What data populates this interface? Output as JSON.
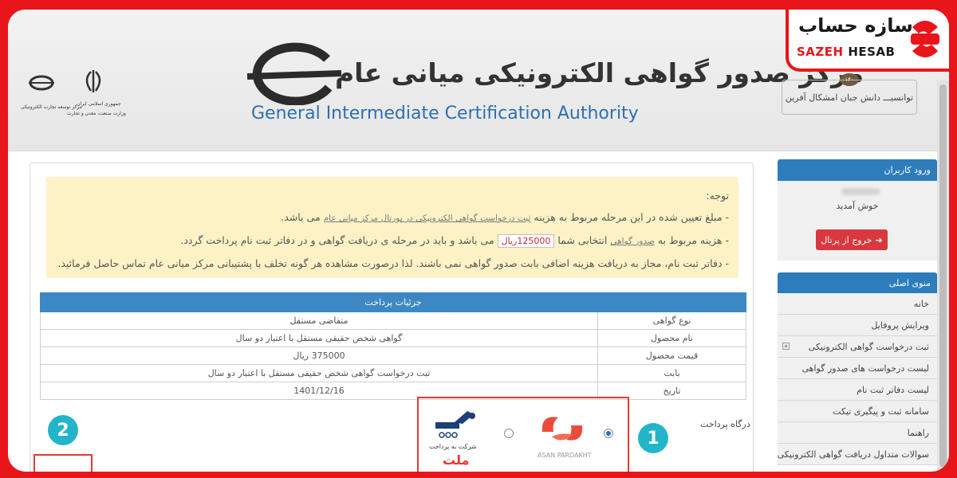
{
  "brand": {
    "name_fa": "سازه حساب",
    "name_en_red": "SAZEH",
    "name_en_dark": "HESAB"
  },
  "header": {
    "title": "مرکز صدور گواهی الکترونیکی میانی عام",
    "subtitle": "General Intermediate Certification Authority",
    "motto": "توانسیـــ دانش جبان امشکال آفرین",
    "gov_line1": "جمهوری اسلامی ایران",
    "gov_line2": "وزارت صنعت، معدن و تجارت",
    "gov_line3": "مرکز توسعه تجارت الکترونیکی"
  },
  "notice": {
    "heading": "توجه:",
    "line1_start": "- مبلغ تعیین شده در این مرحله مربوط به هزینه",
    "line1_link": "ثبت درخواست گواهی الکترونیکی در پورتال مرکز میانی عام",
    "line1_end": "می باشد.",
    "line2_start": "- هزینه مربوط به",
    "line2_link": "صدور گواهی",
    "line2_mid": "انتخابی شما",
    "line2_amount": "125000ریال",
    "line2_end": "می باشد و باید در مرحله ی دریافت گواهی و در دفاتر ثبت نام پرداخت گردد.",
    "line3": "- دفاتر ثبت نام، مجاز به دریافت هزینه اضافی بابت صدور گواهی نمی باشند. لذا درصورت مشاهده هر گونه تخلف با پشتیبانی مرکز میانی عام تماس حاصل فرمائید."
  },
  "payment": {
    "title": "جزئیات پرداخت",
    "rows": [
      {
        "label": "نوع گواهی",
        "value": "متقاضی مستقل"
      },
      {
        "label": "نام محصول",
        "value": "گواهی شخص حقیقی مستقل با اعتبار دو سال"
      },
      {
        "label": "قیمت محصول",
        "value": "375000 ریال"
      },
      {
        "label": "بابت",
        "value": "ثبت درخواست گواهی شخص حقیقی مستقل با اعتبار دو سال"
      },
      {
        "label": "تاریخ",
        "value": "1401/12/16"
      }
    ]
  },
  "gateway": {
    "label": "درگاه پرداخت",
    "asan_caption": "ASAN PARDAKHT",
    "mellat_caption": "شرکت به پرداخت",
    "mellat_name": "ملت",
    "selected": "asan"
  },
  "badges": {
    "one": "1",
    "two": "2"
  },
  "sidebar": {
    "login_title": "ورود کاربران",
    "welcome": "خوش آمدید",
    "exit_label": "خروج از پرتال",
    "menu_title": "منوی اصلی",
    "menu": [
      "خانه",
      "ویرایش پروفایل",
      "ثبت درخواست گواهی الکترونیکی",
      "لیست درخواست های صدور گواهی",
      "لیست دفاتر ثبت نام",
      "سامانه ثبت و پیگیری تیکت",
      "راهنما",
      "سوالات متداول دریافت گواهی الکترونیکی"
    ]
  },
  "colors": {
    "frame": "#e8151b",
    "primary": "#2d7dbd",
    "notice_bg": "#fdf2c6",
    "badge": "#22b5c9",
    "exit": "#d9383e"
  }
}
